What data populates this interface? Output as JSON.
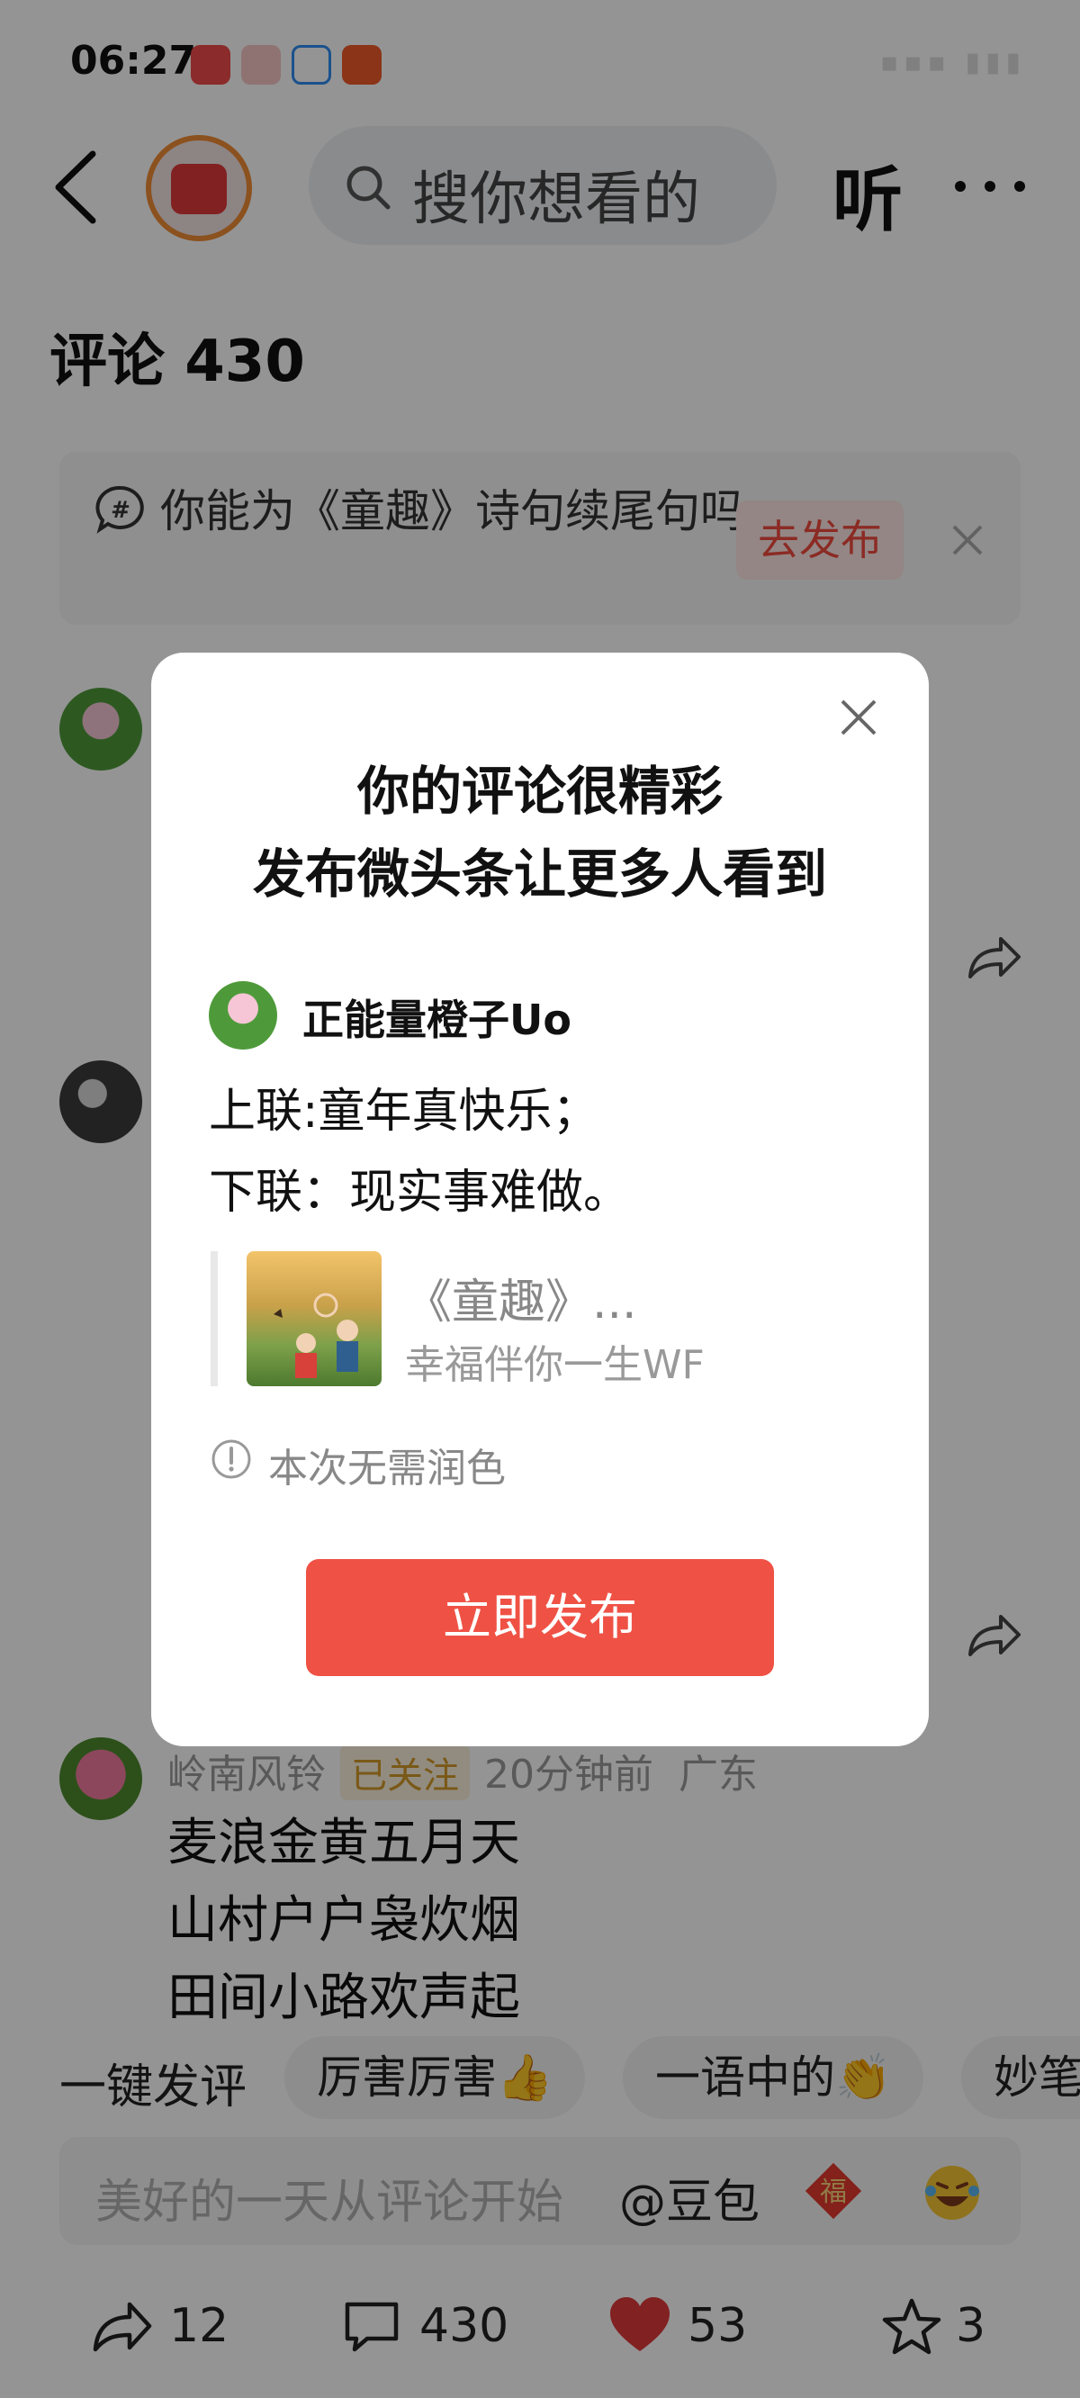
{
  "status_bar": {
    "time": "06:27"
  },
  "header": {
    "search_placeholder": "搜你想看的",
    "listen_label": "听"
  },
  "comments": {
    "title": "评论 430",
    "topic": {
      "text": "你能为《童趣》诗句续尾句吗",
      "button": "去发布"
    },
    "visible_comment": {
      "author": "岭南风铃",
      "follow_badge": "已关注",
      "time": "20分钟前",
      "location": "广东",
      "lines": [
        "麦浪金黄五月天",
        "山村户户袅炊烟",
        "田间小路欢声起"
      ]
    }
  },
  "quick_replies": {
    "label": "一键发评",
    "chips": [
      "厉害厉害👍",
      "一语中的👏",
      "妙笔"
    ]
  },
  "input": {
    "placeholder": "美好的一天从评论开始",
    "mention": "@豆包"
  },
  "bottom_bar": {
    "share_count": "12",
    "comment_count": "430",
    "like_count": "53",
    "favorite_count": "3"
  },
  "modal": {
    "title_line1": "你的评论很精彩",
    "title_line2": "发布微头条让更多人看到",
    "user_name": "正能量橙子Uo",
    "body_line1": "上联:童年真快乐；",
    "body_line2": "下联：现实事难做。",
    "quote_title": "《童趣》...",
    "quote_author": "幸福伴你一生WF",
    "hint": "本次无需润色",
    "publish_button": "立即发布"
  },
  "colors": {
    "accent_red": "#ef5245",
    "badge_gold": "#d39a2a",
    "like_red": "#e1393a"
  }
}
